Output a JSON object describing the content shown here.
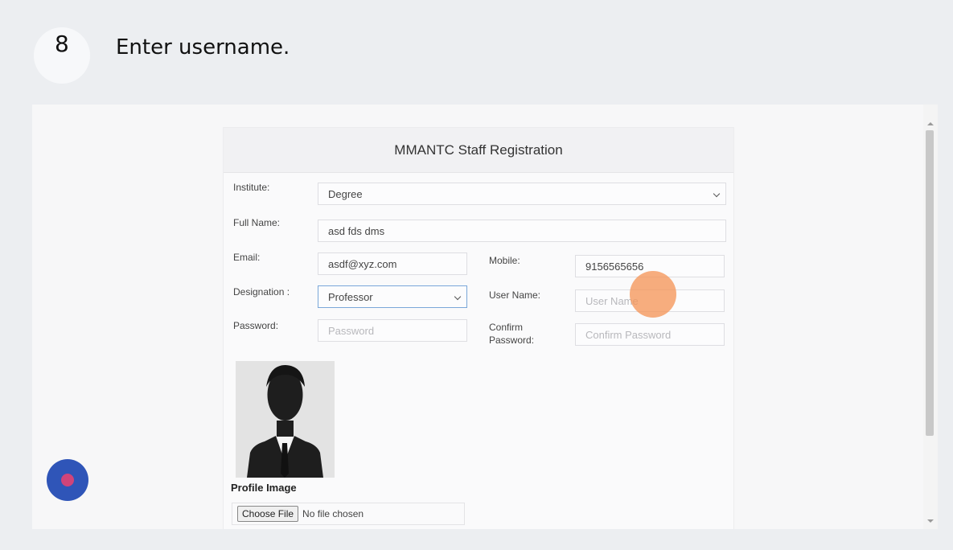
{
  "step": {
    "number": "8",
    "instruction": "Enter username."
  },
  "form": {
    "title": "MMANTC Staff Registration",
    "institute": {
      "label": "Institute:",
      "value": "Degree"
    },
    "full_name": {
      "label": "Full Name:",
      "value": "asd fds dms"
    },
    "email": {
      "label": "Email:",
      "value": "asdf@xyz.com"
    },
    "mobile": {
      "label": "Mobile:",
      "value": "9156565656"
    },
    "designation": {
      "label": "Designation :",
      "value": "Professor"
    },
    "user_name": {
      "label": "User Name:",
      "placeholder": "User Name"
    },
    "password": {
      "label": "Password:",
      "placeholder": "Password"
    },
    "confirm_password": {
      "label_line1": "Confirm",
      "label_line2": "Password:",
      "placeholder": "Confirm Password"
    },
    "profile_image_label": "Profile Image",
    "file_input": {
      "button": "Choose File",
      "status": "No file chosen"
    }
  },
  "colors": {
    "cursor_highlight": "#f5965a",
    "record_button": "#2f55b8",
    "record_dot": "#d0447a",
    "focus_border": "#7aa7d9"
  }
}
